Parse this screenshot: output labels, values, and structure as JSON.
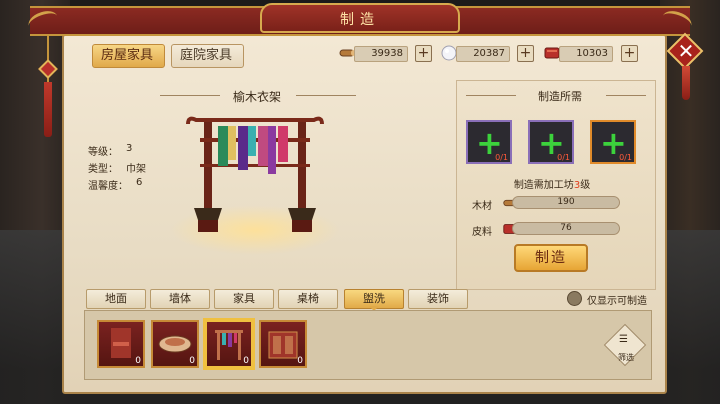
{
  "window": {
    "title": "制造"
  },
  "tabs": [
    {
      "label": "房屋家具",
      "active": true
    },
    {
      "label": "庭院家具",
      "active": false
    }
  ],
  "currencies": [
    {
      "icon": "wood-icon",
      "value": "39938"
    },
    {
      "icon": "pearl-icon",
      "value": "20387"
    },
    {
      "icon": "leather-icon",
      "value": "10303"
    }
  ],
  "item": {
    "name": "榆木衣架",
    "stats": [
      {
        "label": "等级：",
        "value": "3"
      },
      {
        "label": "类型：",
        "value": "巾架"
      },
      {
        "label": "温馨度：",
        "value": "6"
      }
    ]
  },
  "recipe": {
    "title": "制造所需",
    "slots": [
      {
        "count": "0/1",
        "style": "purple"
      },
      {
        "count": "0/1",
        "style": "purple"
      },
      {
        "count": "0/1",
        "style": "orange"
      }
    ],
    "workshop_prefix": "制造需加工坊",
    "workshop_level": "3",
    "workshop_suffix": "级",
    "materials": [
      {
        "label": "木材",
        "icon": "wood-icon",
        "value": "190"
      },
      {
        "label": "皮料",
        "icon": "leather-icon",
        "value": "76"
      }
    ],
    "craft_label": "制造"
  },
  "categories": [
    {
      "label": "地面",
      "active": false
    },
    {
      "label": "墙体",
      "active": false
    },
    {
      "label": "家具",
      "active": false
    },
    {
      "label": "桌椅",
      "active": false
    },
    {
      "label": "盥洗",
      "active": true
    },
    {
      "label": "装饰",
      "active": false
    }
  ],
  "toggle": {
    "label": "仅显示可制造"
  },
  "furniture": [
    {
      "count": "0",
      "selected": false
    },
    {
      "count": "0",
      "selected": false
    },
    {
      "count": "0",
      "selected": true
    },
    {
      "count": "0",
      "selected": false
    }
  ],
  "filter": {
    "label": "筛选"
  },
  "colors": {
    "accent": "#e1aa48",
    "title_red": "#8b2a22",
    "panel": "#f3e8d4"
  }
}
